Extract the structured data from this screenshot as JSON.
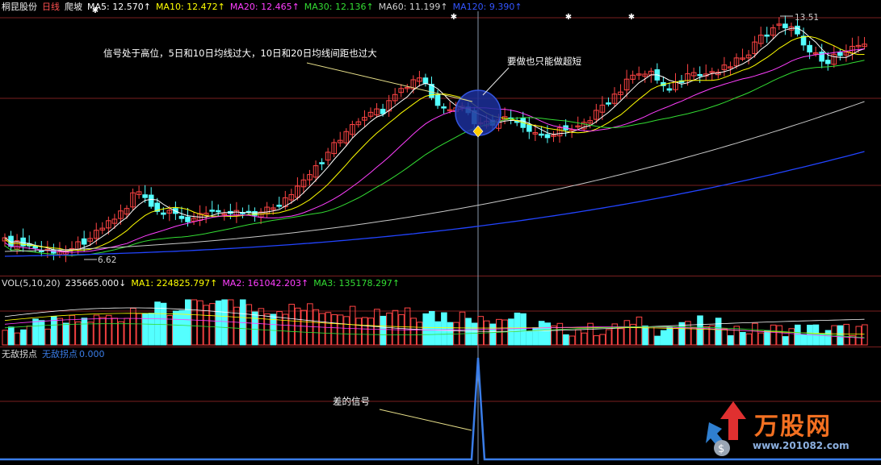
{
  "main_header": {
    "stock_name": "桐昆股份",
    "period": "日线",
    "indicator": "爬坡",
    "ma5": "MA5: 12.570↑",
    "ma10": "MA10: 12.472↑",
    "ma20": "MA20: 12.465↑",
    "ma30": "MA30: 12.136↑",
    "ma60": "MA60: 11.199↑",
    "ma120": "MA120: 9.390↑"
  },
  "vol_header": {
    "label": "VOL(5,10,20)",
    "vol": "235665.000↓",
    "ma1": "MA1: 224825.797↑",
    "ma2": "MA2: 161042.203↑",
    "ma3": "MA3: 135178.297↑"
  },
  "signal_header": {
    "title": "无敌拐点",
    "name": "无敌拐点",
    "value": "0.000"
  },
  "annotations": {
    "high_signal": "信号处于高位，5日和10日均线过大，10日和20日均线间距也过大",
    "short_only": "要做也只能做超短",
    "bad_signal": "差的信号"
  },
  "price_labels": {
    "low": "6.62",
    "high": "13.51"
  },
  "logo": {
    "name": "万股网",
    "url": "www.201082.com"
  },
  "colors": {
    "up": "#ff4444",
    "down": "#54ffff",
    "ma5": "#ffffff",
    "ma10": "#ffff00",
    "ma20": "#ff3fff",
    "ma30": "#33dd33",
    "ma60": "#c8c8c8",
    "ma120": "#2244ff",
    "signal": "#3a7de8",
    "grid": "#7a1f1f"
  },
  "chart_data": {
    "type": "candlestick",
    "price_range": [
      6.3,
      14.0
    ],
    "low_marker": 6.62,
    "high_marker": 13.51,
    "signal_peak_value": 1
  }
}
